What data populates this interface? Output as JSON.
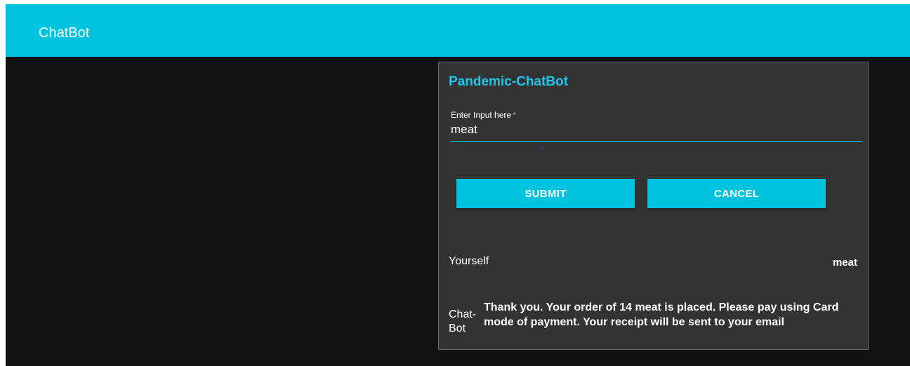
{
  "header": {
    "title": "ChatBot",
    "color": "#00c3e0"
  },
  "card": {
    "title": "Pandemic-ChatBot",
    "input": {
      "label": "Enter Input here",
      "required_mark": "*",
      "value": "meat"
    },
    "buttons": {
      "submit": "SUBMIT",
      "cancel": "CANCEL"
    },
    "conversation": {
      "user_label": "Yourself",
      "user_message": "meat",
      "bot_label": "Chat-Bot",
      "bot_message": "Thank you. Your order of 14 meat is placed. Please pay using Card mode of payment. Your receipt will be sent to your email"
    }
  },
  "colors": {
    "accent": "#00c3e0",
    "background": "#121212",
    "card": "#333333"
  }
}
